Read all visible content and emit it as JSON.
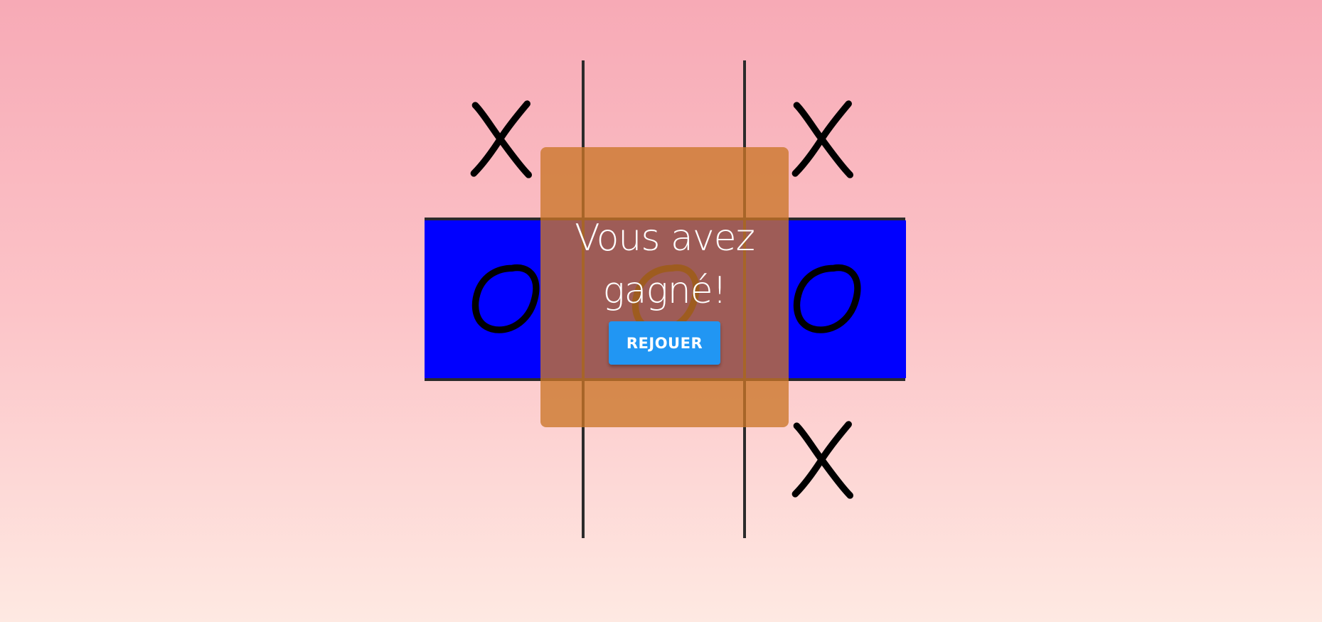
{
  "game": {
    "cells": [
      "X",
      "",
      "X",
      "O",
      "O",
      "O",
      "",
      "",
      "X"
    ],
    "winning_cells": [
      3,
      4,
      5
    ],
    "colors": {
      "background_top": "#f7aab6",
      "background_bottom": "#fee9e2",
      "grid_line": "#2b2b2b",
      "mark": "#000000",
      "win_highlight": "#0000ff",
      "overlay": "#ca7628"
    }
  },
  "result": {
    "message": "Vous avez gagné!",
    "replay_label": "REJOUER",
    "button_color": "#2196f3"
  }
}
